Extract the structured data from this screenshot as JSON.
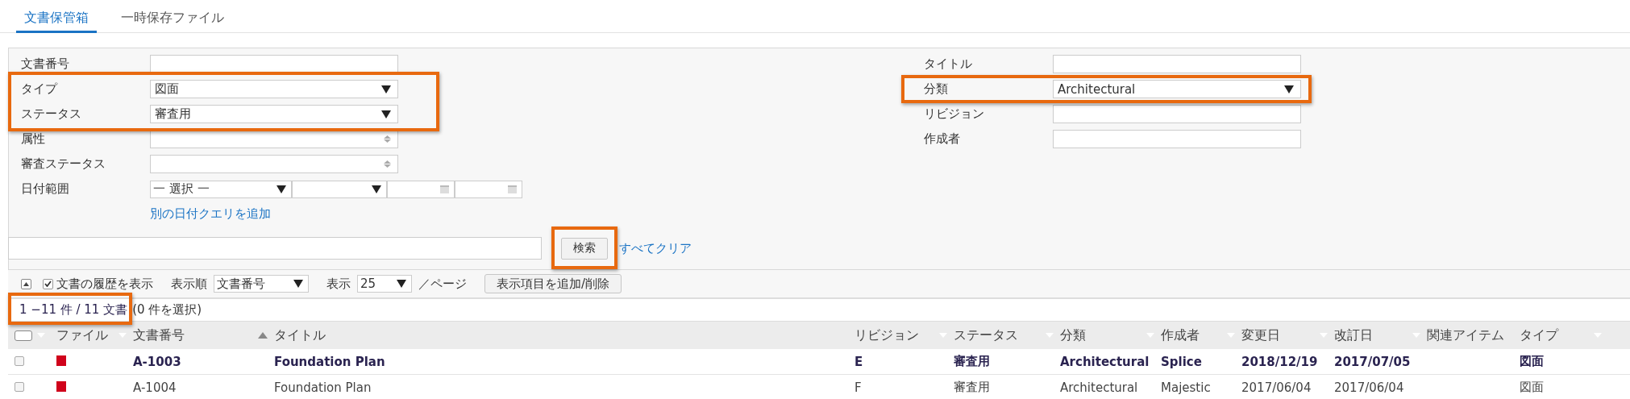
{
  "tabs": [
    {
      "label": "文書保管箱",
      "selected": true
    },
    {
      "label": "一時保存ファイル",
      "selected": false
    }
  ],
  "filters": {
    "left": [
      {
        "label": "文書番号",
        "kind": "text",
        "highlighted": false
      },
      {
        "label": "タイプ",
        "kind": "select",
        "value": "図面",
        "highlighted": true
      },
      {
        "label": "ステータス",
        "kind": "select",
        "value": "審査用",
        "highlighted": true
      },
      {
        "label": "属性",
        "kind": "combo",
        "highlighted": false
      },
      {
        "label": "審査ステータス",
        "kind": "combo",
        "highlighted": false
      }
    ],
    "right": [
      {
        "label": "タイトル",
        "kind": "text",
        "highlighted": false
      },
      {
        "label": "分類",
        "kind": "select",
        "value": "Architectural",
        "highlighted": true
      },
      {
        "label": "リビジョン",
        "kind": "text",
        "highlighted": false
      },
      {
        "label": "作成者",
        "kind": "text",
        "highlighted": false
      }
    ],
    "date_range": {
      "label": "日付範囲",
      "period": "一 選択 一"
    },
    "add_date_query": "別の日付クエリを追加"
  },
  "search": {
    "button": "検索",
    "button_highlighted": true,
    "clear_all": "すべてクリア"
  },
  "toolbar": {
    "show_history": {
      "label": "文書の履歴を表示",
      "checked": true
    },
    "sort": {
      "label": "表示順",
      "value": "文書番号"
    },
    "per_page": {
      "label": "表示",
      "value": "25",
      "suffix": "／ページ"
    },
    "columns_button": "表示項目を追加/削除"
  },
  "count": {
    "range": "1 −11 件 / 11 文書",
    "selected": "(0 件を選択)",
    "highlighted": true
  },
  "table": {
    "select_all_checked": false,
    "columns": [
      "ファイル",
      "文書番号",
      "タイトル",
      "リビジョン",
      "ステータス",
      "分類",
      "作成者",
      "変更日",
      "改訂日",
      "関連アイテム",
      "タイプ"
    ],
    "rows": [
      {
        "checked": false,
        "unread": true,
        "cells": [
          "",
          "A-1003",
          "Foundation Plan",
          "E",
          "審査用",
          "Architectural",
          "Splice",
          "2018/12/19",
          "2017/07/05",
          "",
          "図面"
        ]
      },
      {
        "checked": false,
        "unread": false,
        "cells": [
          "",
          "A-1004",
          "Foundation Plan",
          "F",
          "審査用",
          "Architectural",
          "Majestic",
          "2017/06/04",
          "2017/06/04",
          "",
          "図面"
        ]
      }
    ]
  }
}
